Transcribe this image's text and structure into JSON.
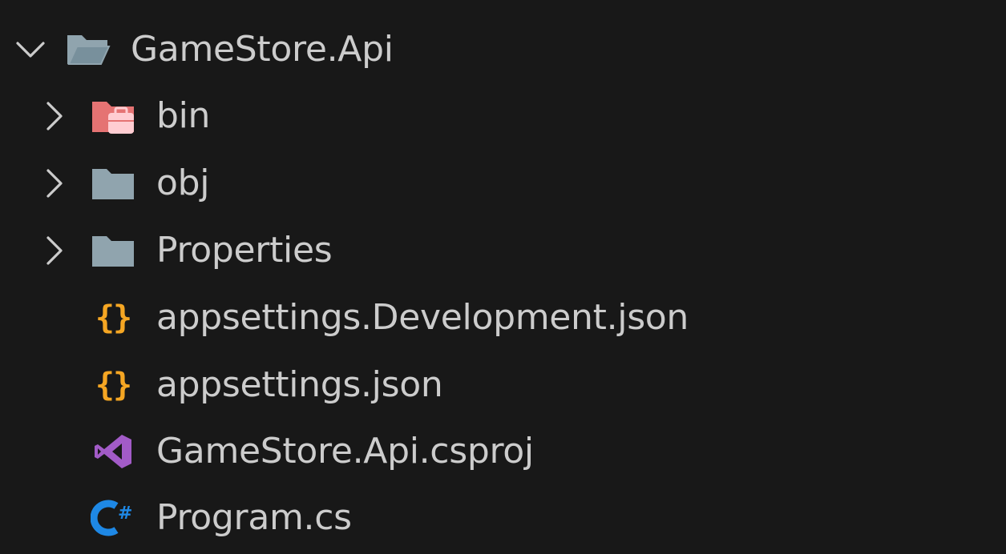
{
  "explorer": {
    "root": {
      "label": "GameStore.Api",
      "expanded": true,
      "icon": "folder-open-icon"
    },
    "items": [
      {
        "label": "bin",
        "type": "folder",
        "expanded": false,
        "icon": "folder-bin-icon",
        "icon_color": "#e57373"
      },
      {
        "label": "obj",
        "type": "folder",
        "expanded": false,
        "icon": "folder-icon",
        "icon_color": "#90a4ae"
      },
      {
        "label": "Properties",
        "type": "folder",
        "expanded": false,
        "icon": "folder-icon",
        "icon_color": "#90a4ae"
      },
      {
        "label": "appsettings.Development.json",
        "type": "file",
        "icon": "json-icon",
        "icon_glyph": "{}",
        "icon_color": "#f5a623"
      },
      {
        "label": "appsettings.json",
        "type": "file",
        "icon": "json-icon",
        "icon_glyph": "{}",
        "icon_color": "#f5a623"
      },
      {
        "label": "GameStore.Api.csproj",
        "type": "file",
        "icon": "visual-studio-icon",
        "icon_color": "#a25bc7"
      },
      {
        "label": "Program.cs",
        "type": "file",
        "icon": "csharp-icon",
        "icon_glyph": "#",
        "icon_color": "#1e88e5"
      }
    ]
  }
}
